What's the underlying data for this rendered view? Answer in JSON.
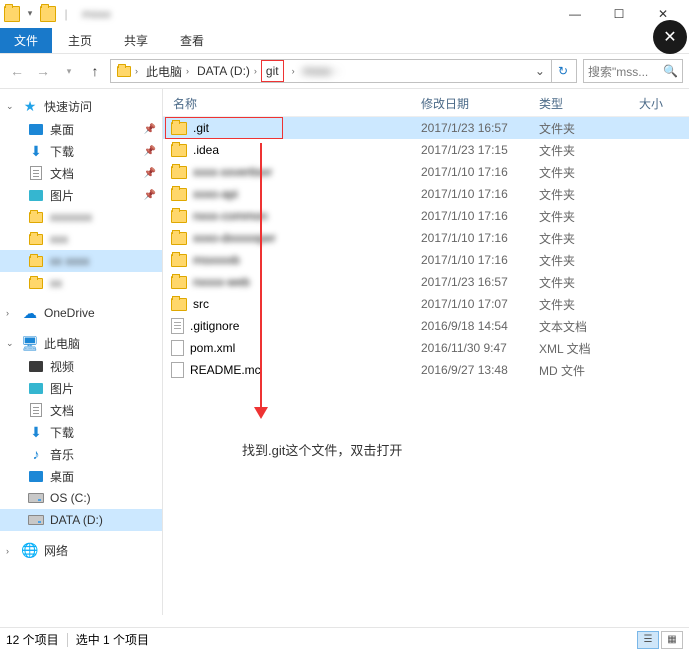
{
  "title": "msso",
  "ribbon": {
    "file": "文件",
    "home": "主页",
    "share": "共享",
    "view": "查看"
  },
  "nav": {
    "seg_pc": "此电脑",
    "seg_drive": "DATA (D:)",
    "seg_git": "git",
    "seg_last": "msso",
    "search_placeholder": "搜索\"mss...",
    "refresh": "↻"
  },
  "sidebar": {
    "quick": "快速访问",
    "desktop": "桌面",
    "downloads": "下载",
    "documents": "文档",
    "pictures": "图片",
    "blur1": "xxxxxxx",
    "blur2": "xxx",
    "blur3": "xx xxxx",
    "blur4": "xx",
    "onedrive": "OneDrive",
    "thispc": "此电脑",
    "video": "视频",
    "pictures2": "图片",
    "documents2": "文档",
    "downloads2": "下载",
    "music": "音乐",
    "desktop2": "桌面",
    "drive_c": "OS (C:)",
    "drive_d": "DATA (D:)",
    "network": "网络"
  },
  "columns": {
    "name": "名称",
    "date": "修改日期",
    "type": "类型",
    "size": "大小"
  },
  "files": [
    {
      "name": ".git",
      "date": "2017/1/23 16:57",
      "type": "文件夹",
      "icon": "folder",
      "sel": true,
      "hl": true
    },
    {
      "name": ".idea",
      "date": "2017/1/23 17:15",
      "type": "文件夹",
      "icon": "folder"
    },
    {
      "name": "msso-advertiser",
      "date": "2017/1/10 17:16",
      "type": "文件夹",
      "icon": "folder",
      "blur": true,
      "showname": "xxxx-xxvertiser"
    },
    {
      "name": "msso-api",
      "date": "2017/1/10 17:16",
      "type": "文件夹",
      "icon": "folder",
      "blur": true,
      "showname": "xxxo-api"
    },
    {
      "name": "msso-common",
      "date": "2017/1/10 17:16",
      "type": "文件夹",
      "icon": "folder",
      "blur": true,
      "showname": "nxxx-common"
    },
    {
      "name": "msso-developer",
      "date": "2017/1/10 17:16",
      "type": "文件夹",
      "icon": "folder",
      "blur": true,
      "showname": "xxxo-dxxxxxper"
    },
    {
      "name": "msso-b",
      "date": "2017/1/10 17:16",
      "type": "文件夹",
      "icon": "folder",
      "blur": true,
      "showname": "msxxxxb"
    },
    {
      "name": "msso-web",
      "date": "2017/1/23 16:57",
      "type": "文件夹",
      "icon": "folder",
      "blur": true,
      "showname": "nxxxx-web"
    },
    {
      "name": "src",
      "date": "2017/1/10 17:07",
      "type": "文件夹",
      "icon": "folder"
    },
    {
      "name": ".gitignore",
      "date": "2016/9/18 14:54",
      "type": "文本文档",
      "icon": "txt"
    },
    {
      "name": "pom.xml",
      "date": "2016/11/30 9:47",
      "type": "XML 文档",
      "icon": "file"
    },
    {
      "name": "README.md",
      "date": "2016/9/27 13:48",
      "type": "MD 文件",
      "icon": "file",
      "showname": "README.mc"
    }
  ],
  "annotation": "找到.git这个文件，双击打开",
  "status": {
    "count": "12 个项目",
    "selected": "选中 1 个项目"
  }
}
